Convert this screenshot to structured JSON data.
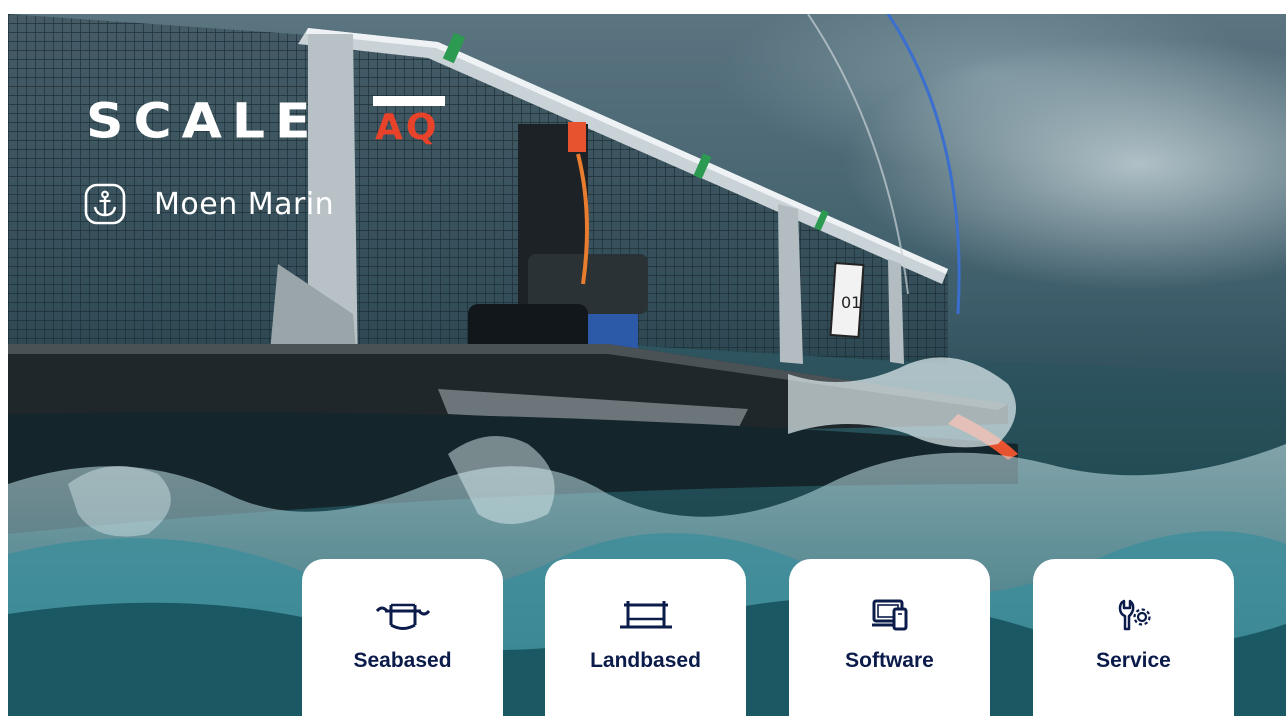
{
  "brand": {
    "logo_word": "SCALE",
    "logo_suffix": "AQ",
    "company": "Moen Marin"
  },
  "colors": {
    "accent": "#e8432a",
    "navy": "#0b1b4a",
    "white": "#ffffff"
  },
  "cards": [
    {
      "label": "Seabased",
      "icon": "sea-cage-icon"
    },
    {
      "label": "Landbased",
      "icon": "land-tank-icon"
    },
    {
      "label": "Software",
      "icon": "devices-icon"
    },
    {
      "label": "Service",
      "icon": "wrench-gear-icon"
    }
  ],
  "pen_sign": "01"
}
